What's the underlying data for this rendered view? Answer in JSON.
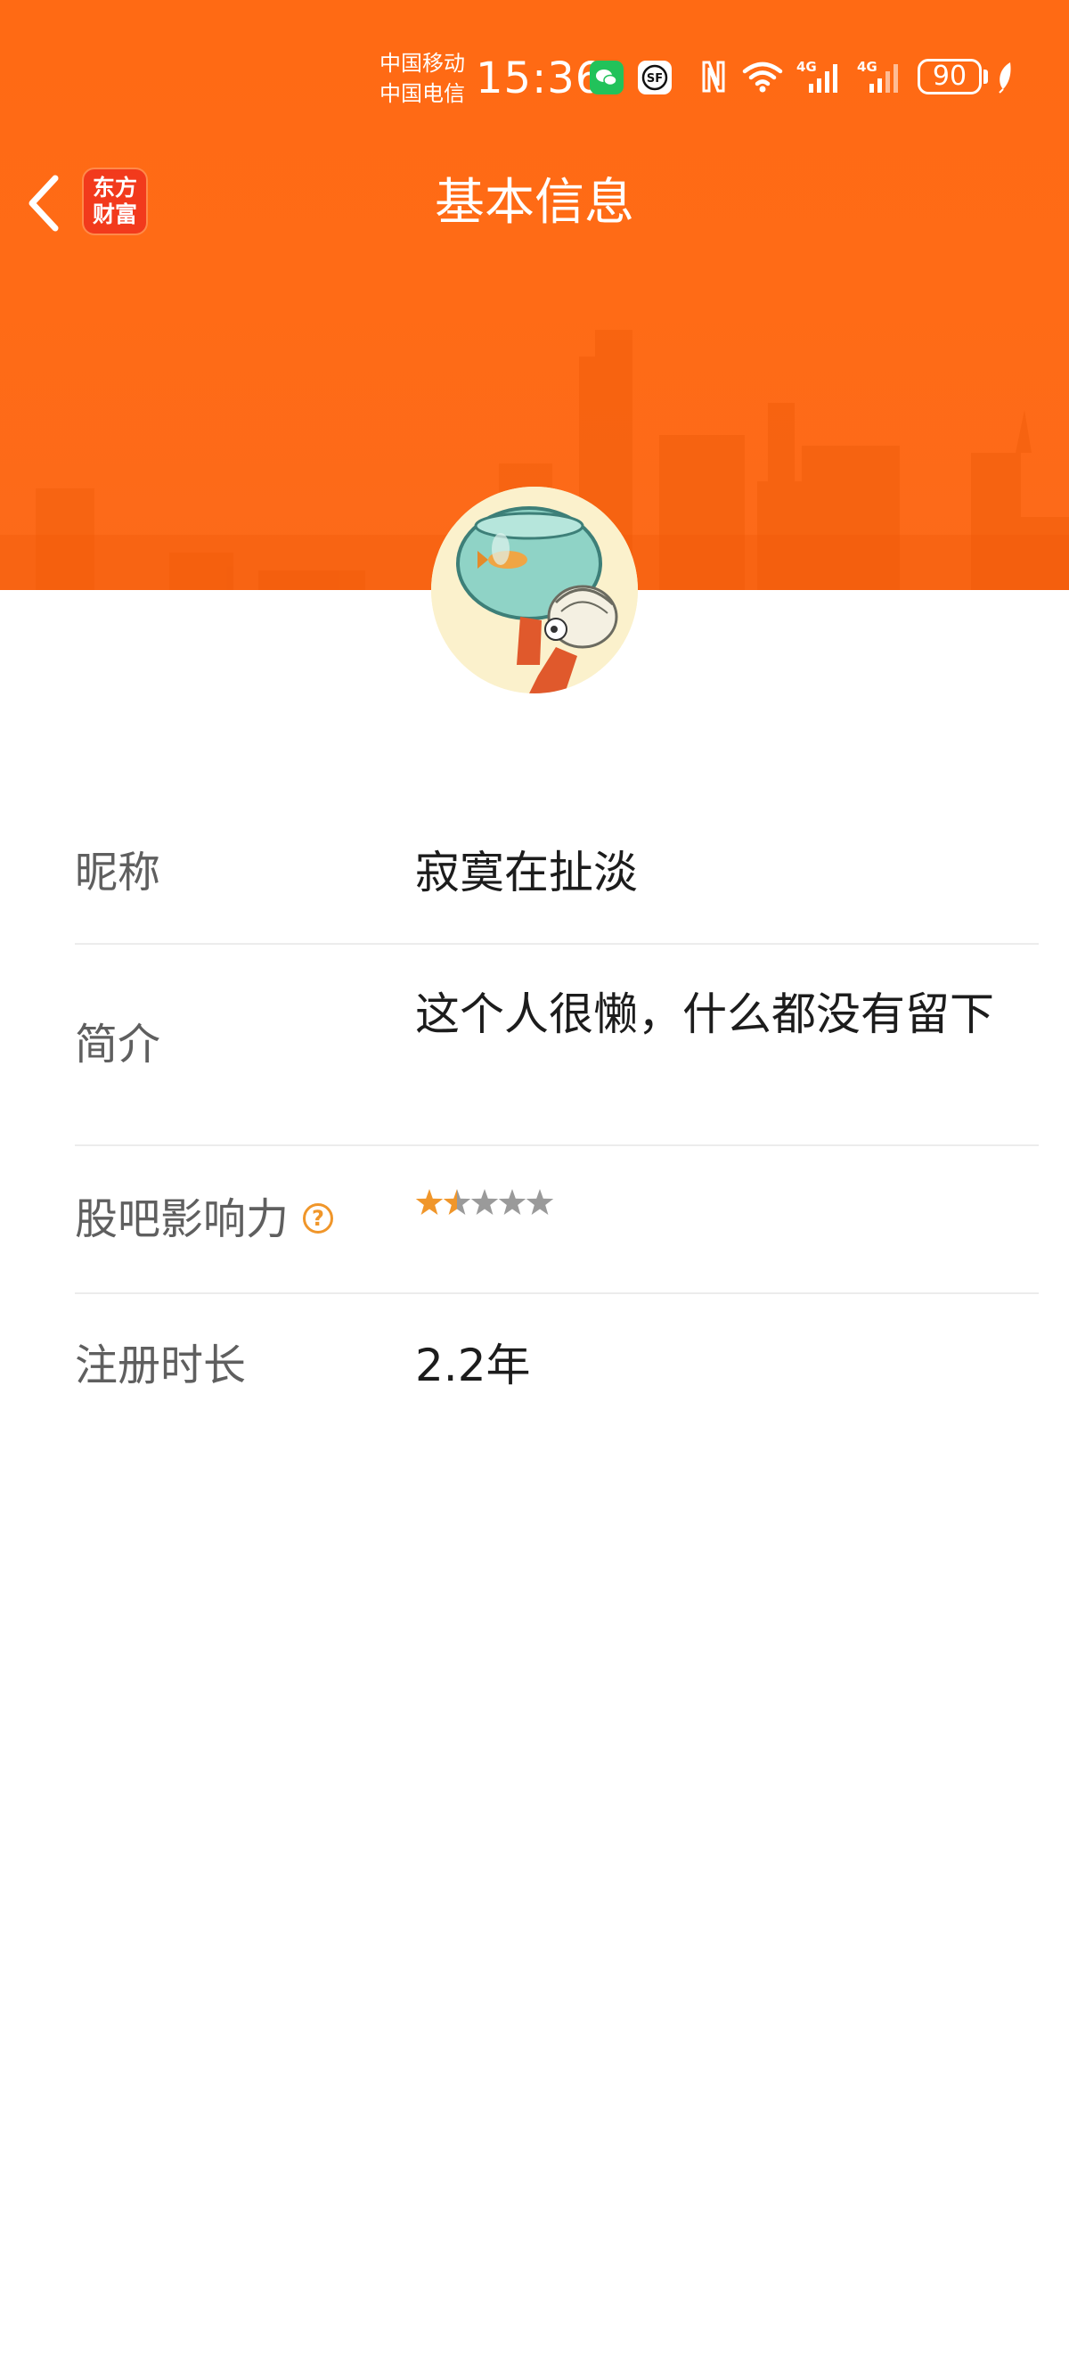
{
  "status_bar": {
    "carrier_1": "中国移动",
    "carrier_2": "中国电信",
    "time": "15:36",
    "battery": "90",
    "icons": [
      "wechat-icon",
      "sf-express-icon",
      "nfc-icon",
      "wifi-icon",
      "signal-4g-icon",
      "signal-4g-icon",
      "leaf-icon"
    ]
  },
  "nav": {
    "back_icon": "chevron-left-icon",
    "logo_text": "东方\n财富",
    "title": "基本信息"
  },
  "colors": {
    "header_orange": "#ff6b16",
    "star_active": "#f0962a",
    "star_inactive": "#9a9a9a",
    "label_gray": "#5f5f5f"
  },
  "profile": {
    "nickname_label": "昵称",
    "nickname_value": "寂寞在扯淡",
    "intro_label": "简介",
    "intro_value": "这个人很懒，什么都没有留下",
    "influence_label": "股吧影响力",
    "influence_help_icon": "question-circle-icon",
    "influence_rating": 1.5,
    "influence_max": 5,
    "register_label": "注册时长",
    "register_value": "2.2年"
  }
}
